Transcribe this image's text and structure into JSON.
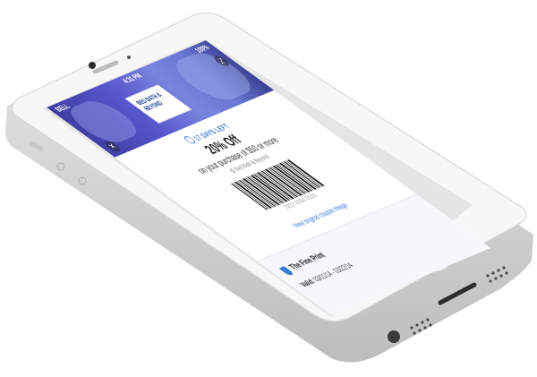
{
  "status_bar": {
    "carrier": "BELL",
    "time": "4:31 PM",
    "battery": "100%"
  },
  "merchant_logo": {
    "text_line1": "BED BATH &",
    "text_line2": "BEYOND"
  },
  "coupon": {
    "days_left": "17 DAYS LEFT",
    "title": "20% Off",
    "subtitle": "on your purchase of $50 or more",
    "merchant": "@ Bed Bath & Beyond",
    "barcode_number": "2837 0384 0536",
    "view_link": "View original coupon image"
  },
  "fine_print": {
    "title": "The Fine Print",
    "valid_label": "Valid:",
    "valid_dates": "03/01/14 - 03/22/14"
  },
  "icons": {
    "close": "close-icon",
    "expand": "expand-icon",
    "clock": "clock-icon",
    "shield": "shield-icon"
  },
  "colors": {
    "accent": "#3a7bd5",
    "hero": "#5856c9",
    "phone_body": "#f4f4f4"
  }
}
